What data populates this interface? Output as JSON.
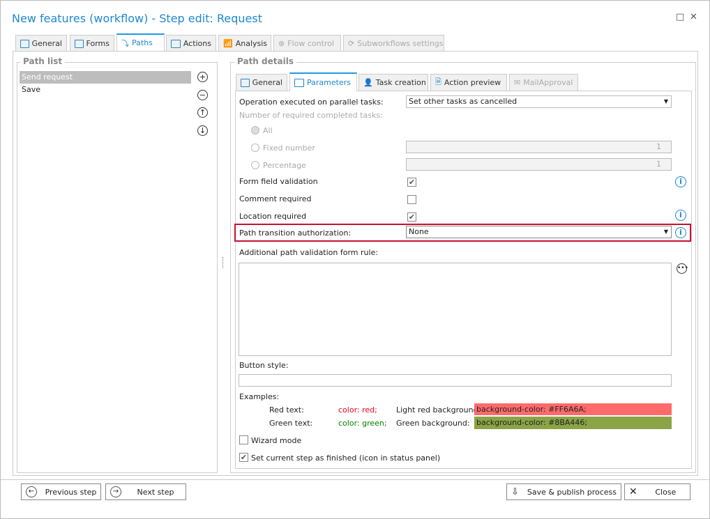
{
  "window": {
    "title": "New features (workflow) - Step edit: Request",
    "maximize": "□",
    "close": "✕"
  },
  "tabs": [
    {
      "label": "General"
    },
    {
      "label": "Forms"
    },
    {
      "label": "Paths"
    },
    {
      "label": "Actions"
    },
    {
      "label": "Analysis"
    },
    {
      "label": "Flow control"
    },
    {
      "label": "Subworkflows settings"
    }
  ],
  "path_list": {
    "title": "Path list",
    "items": [
      "Send request",
      "Save"
    ],
    "buttons": [
      "+",
      "−",
      "↑",
      "↓"
    ]
  },
  "path_details": {
    "title": "Path details",
    "tabs": [
      {
        "label": "General"
      },
      {
        "label": "Parameters"
      },
      {
        "label": "Task creation"
      },
      {
        "label": "Action preview"
      },
      {
        "label": "MailApproval"
      }
    ],
    "operation_label": "Operation executed on parallel tasks:",
    "operation_value": "Set other tasks as cancelled",
    "required_label": "Number of required completed tasks:",
    "radio_all": "All",
    "radio_fixed": "Fixed number",
    "radio_percentage": "Percentage",
    "fixed_value": "1",
    "percentage_value": "1",
    "form_validation_label": "Form field validation",
    "form_validation_checked": true,
    "comment_label": "Comment required",
    "comment_checked": false,
    "location_label": "Location required",
    "location_checked": true,
    "auth_label": "Path transition authorization:",
    "auth_value": "None",
    "additional_label": "Additional path validation form rule:",
    "additional_value": "",
    "button_style_label": "Button style:",
    "button_style_value": "",
    "examples_label": "Examples:",
    "red_text_label": "Red text:",
    "red_text_code": "color: red;",
    "light_red_label": "Light red background:",
    "light_red_code": "background-color: #FF6A6A;",
    "green_text_label": "Green text:",
    "green_text_code": "color: green;",
    "green_bg_label": "Green background:",
    "green_bg_code": "background-color: #8BA446;",
    "wizard_label": "Wizard mode",
    "wizard_checked": false,
    "finished_label": "Set current step as finished (icon in status panel)",
    "finished_checked": true
  },
  "footer": {
    "previous": "Previous step",
    "next": "Next step",
    "save": "Save & publish process",
    "close": "Close"
  },
  "colors": {
    "accent": "#1e88d0",
    "highlight_border": "#c8102e",
    "light_red": "#FF6A6A",
    "green": "#8BA446"
  }
}
